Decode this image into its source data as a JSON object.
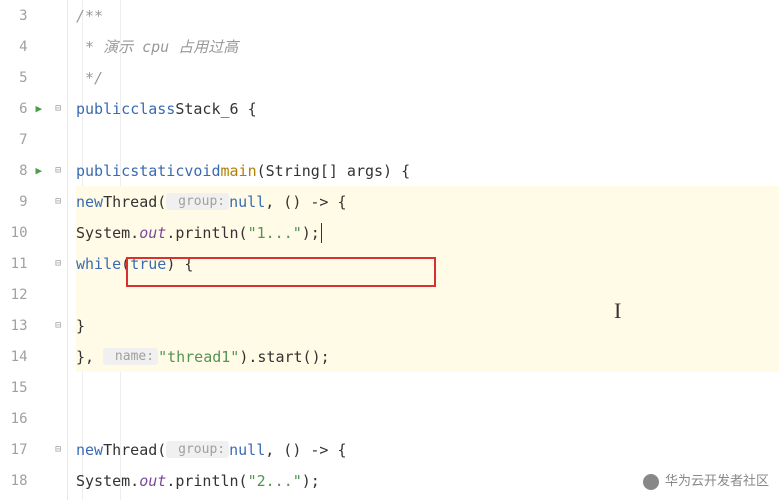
{
  "gutter": {
    "lines": [
      {
        "num": "3",
        "run": false,
        "fold": ""
      },
      {
        "num": "4",
        "run": false,
        "fold": ""
      },
      {
        "num": "5",
        "run": false,
        "fold": ""
      },
      {
        "num": "6",
        "run": true,
        "fold": "⊟"
      },
      {
        "num": "7",
        "run": false,
        "fold": ""
      },
      {
        "num": "8",
        "run": true,
        "fold": "⊟"
      },
      {
        "num": "9",
        "run": false,
        "fold": "⊟"
      },
      {
        "num": "10",
        "run": false,
        "fold": ""
      },
      {
        "num": "11",
        "run": false,
        "fold": "⊟"
      },
      {
        "num": "12",
        "run": false,
        "fold": ""
      },
      {
        "num": "13",
        "run": false,
        "fold": "⊟"
      },
      {
        "num": "14",
        "run": false,
        "fold": ""
      },
      {
        "num": "15",
        "run": false,
        "fold": ""
      },
      {
        "num": "16",
        "run": false,
        "fold": ""
      },
      {
        "num": "17",
        "run": false,
        "fold": "⊟"
      },
      {
        "num": "18",
        "run": false,
        "fold": ""
      }
    ]
  },
  "code": {
    "l3": {
      "a": "/**"
    },
    "l4": {
      "a": " * 演示 cpu 占用过高"
    },
    "l5": {
      "a": " */"
    },
    "l6": {
      "kw1": "public",
      "kw2": "class",
      "name": "Stack_6",
      "open": " {"
    },
    "l8": {
      "kw1": "public",
      "kw2": "static",
      "kw3": "void",
      "method": "main",
      "params": "(String[] args) {"
    },
    "l9": {
      "kw": "new",
      "cls": "Thread",
      "open": "(",
      "hint": " group:",
      "null": "null",
      "sep": ", () -> {"
    },
    "l10": {
      "sys": "System.",
      "out": "out",
      "dot": ".println(",
      "str": "\"1...\"",
      "end": ");"
    },
    "l11": {
      "kw": "while",
      "open": "(",
      "true": "true",
      "close": ") {"
    },
    "l13": {
      "close": "}"
    },
    "l14": {
      "close": "}, ",
      "hint": " name:",
      "str": "\"thread1\"",
      "end": ").start();"
    },
    "l17": {
      "kw": "new",
      "cls": "Thread",
      "open": "(",
      "hint": " group:",
      "null": "null",
      "sep": ", () -> {"
    },
    "l18": {
      "sys": "System.",
      "out": "out",
      "dot": ".println(",
      "str": "\"2...\"",
      "end": ");"
    }
  },
  "watermark": "华为云开发者社区"
}
